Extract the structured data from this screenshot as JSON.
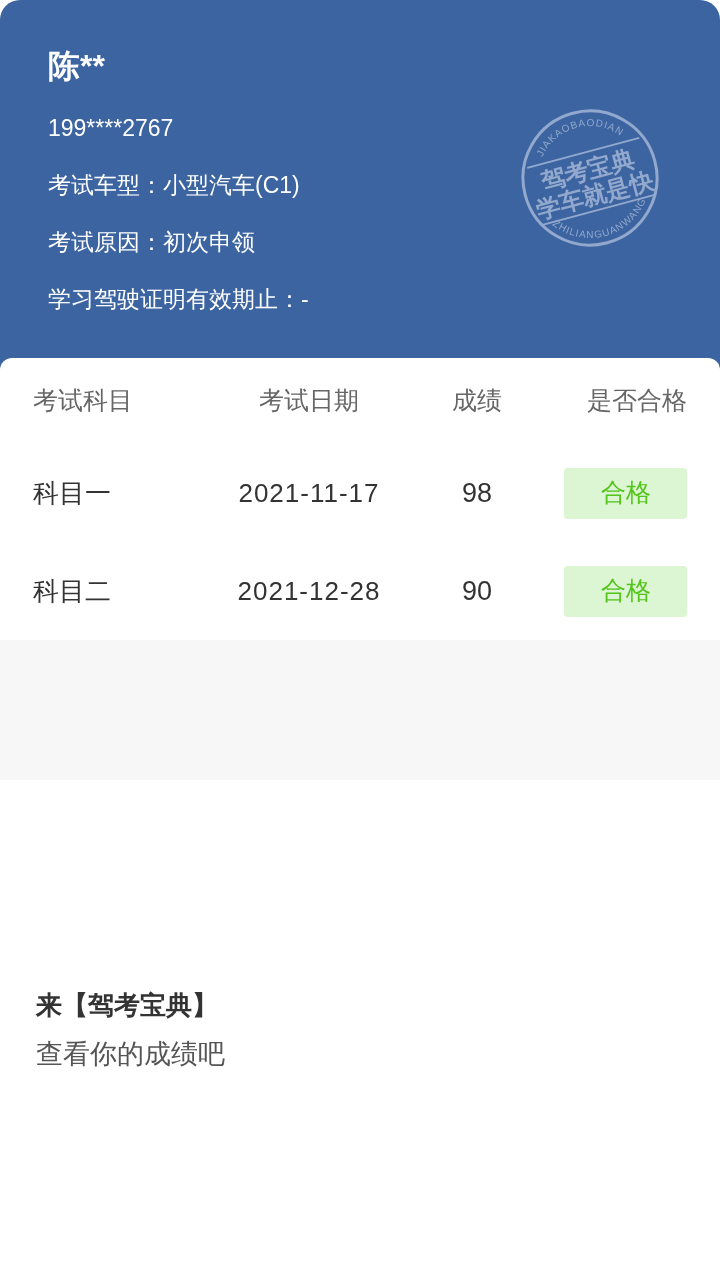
{
  "profile": {
    "name": "陈**",
    "phone": "199****2767",
    "lines": [
      "考试车型：小型汽车(C1)",
      "考试原因：初次申领",
      "学习驾驶证明有效期止：-"
    ]
  },
  "stamp": {
    "top_arc": "JIAKAOBAODIAN",
    "lines": [
      "驾考宝典",
      "学车就是快"
    ],
    "bottom_arc": "ZHILIANGUANWANG"
  },
  "table": {
    "columns": [
      "考试科目",
      "考试日期",
      "成绩",
      "是否合格"
    ],
    "rows": [
      {
        "subject": "科目一",
        "date": "2021-11-17",
        "score": "98",
        "result": "合格",
        "passed": true
      },
      {
        "subject": "科目二",
        "date": "2021-12-28",
        "score": "90",
        "result": "合格",
        "passed": true
      }
    ]
  },
  "promo": {
    "title": "来【驾考宝典】",
    "subtitle": "查看你的成绩吧"
  }
}
